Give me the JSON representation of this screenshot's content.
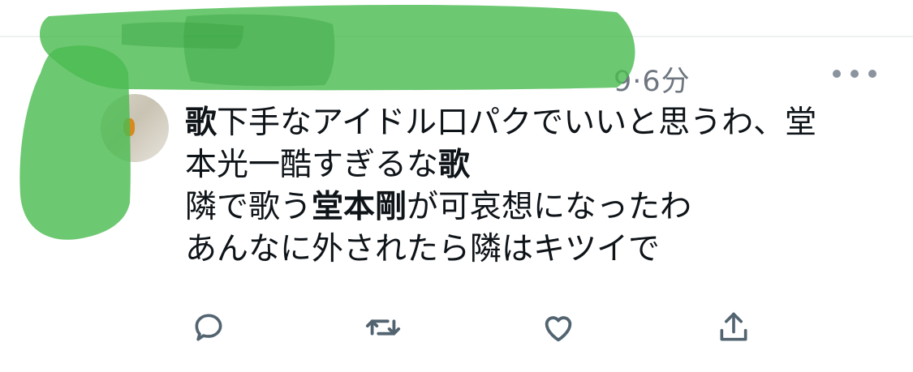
{
  "tweet": {
    "timestamp": "9·6分",
    "lines": [
      [
        {
          "t": "歌",
          "b": true
        },
        {
          "t": "下手なアイドル口パクでいいと思うわ、堂",
          "b": false
        }
      ],
      [
        {
          "t": "本光一酷すぎるな",
          "b": false
        },
        {
          "t": "歌",
          "b": true
        }
      ],
      [
        {
          "t": "隣で歌う",
          "b": false
        },
        {
          "t": "堂本剛",
          "b": true
        },
        {
          "t": "が可哀想になったわ",
          "b": false
        }
      ],
      [
        {
          "t": "あんなに外されたら隣はキツイで",
          "b": false
        }
      ]
    ]
  },
  "icons": {
    "more": "more-horizontal-icon",
    "reply": "reply-icon",
    "retweet": "retweet-icon",
    "like": "heart-icon",
    "share": "share-icon"
  },
  "colors": {
    "text": "#0f1419",
    "secondary_text": "#6e7680",
    "icon": "#536471",
    "censor_marker": "#4cbc52",
    "divider": "#eef0f2"
  }
}
